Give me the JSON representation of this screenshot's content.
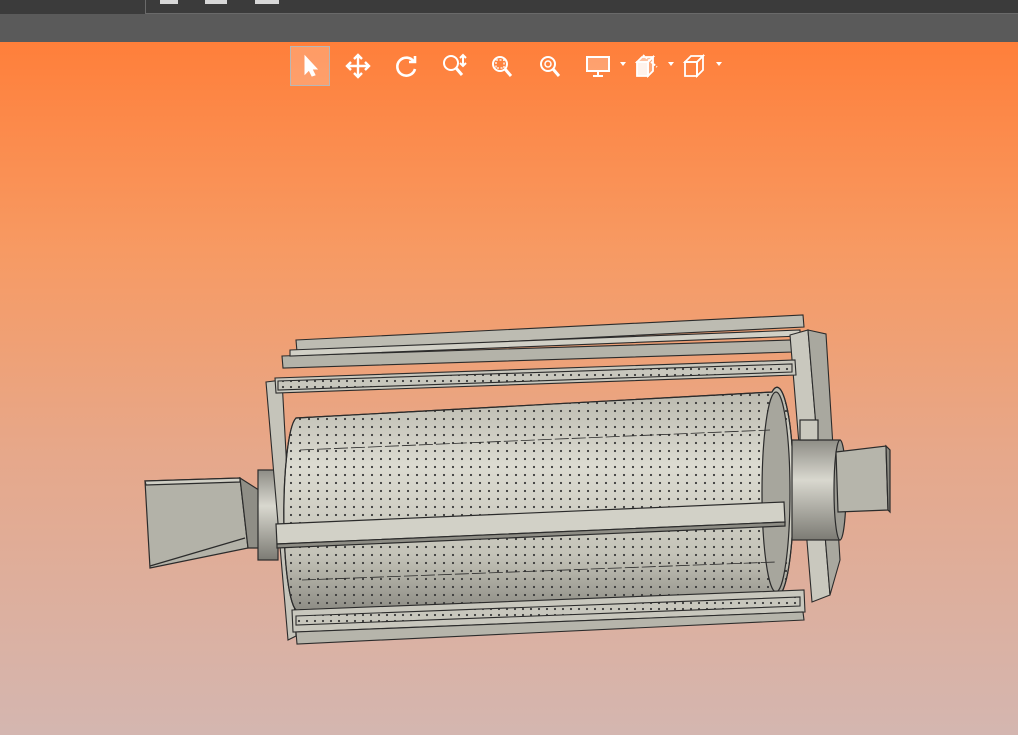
{
  "window": {
    "top_strip_color": "#3b3b3b",
    "bar_color": "#5a5a5a"
  },
  "viewport": {
    "gradient_top": "#ff7f3a",
    "gradient_bottom": "#d4b6b0"
  },
  "toolbar": {
    "tools": [
      {
        "name": "select",
        "icon": "arrow-cursor-icon",
        "active": true
      },
      {
        "name": "pan",
        "icon": "move-arrows-icon",
        "active": false
      },
      {
        "name": "rotate",
        "icon": "rotate-icon",
        "active": false
      },
      {
        "name": "zoom-dynamic",
        "icon": "zoom-dynamic-icon",
        "active": false
      },
      {
        "name": "zoom-window",
        "icon": "zoom-window-icon",
        "active": false
      },
      {
        "name": "zoom-fit",
        "icon": "zoom-fit-icon",
        "active": false
      },
      {
        "name": "display-mode",
        "icon": "monitor-icon",
        "active": false,
        "dropdown": true
      },
      {
        "name": "section-view",
        "icon": "section-cube-icon",
        "active": false,
        "dropdown": true
      },
      {
        "name": "view-orientation",
        "icon": "cube-icon",
        "active": false,
        "dropdown": true
      }
    ]
  },
  "model": {
    "fill_color": "#c7c6bd",
    "edge_color": "#2b2b2b",
    "hole_color": "#3a3a3a"
  }
}
